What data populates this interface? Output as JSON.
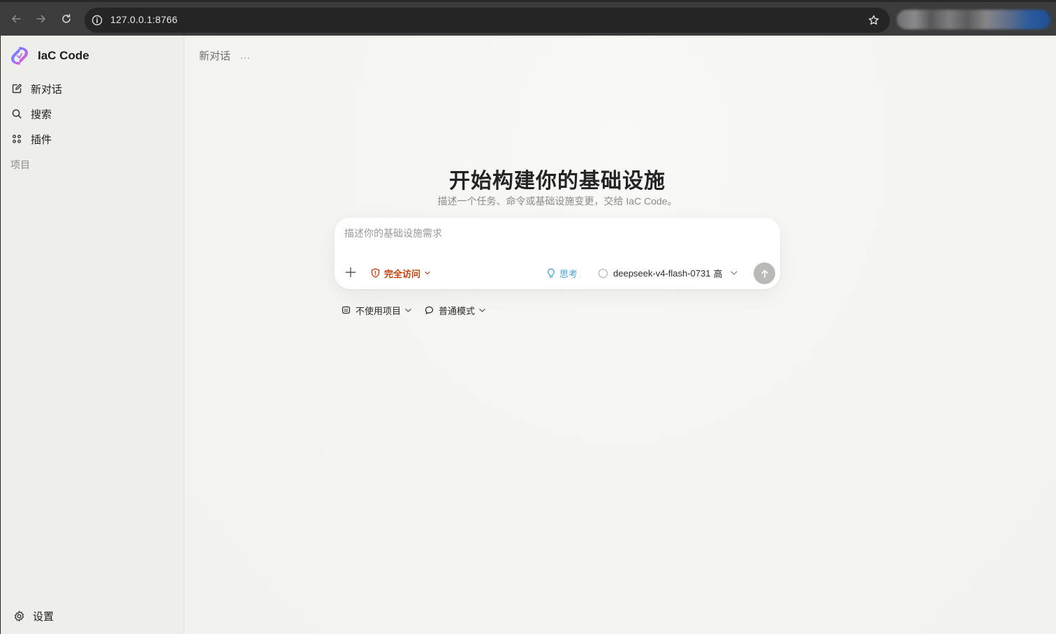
{
  "browser": {
    "url": "127.0.0.1:8766",
    "icons": [
      "back-icon",
      "forward-icon",
      "reload-icon",
      "info-icon",
      "star-icon"
    ]
  },
  "sidebar": {
    "brand": "IaC Code",
    "items": [
      {
        "label": "新对话",
        "icon": "new-chat-icon"
      },
      {
        "label": "搜索",
        "icon": "search-icon"
      },
      {
        "label": "插件",
        "icon": "plugins-icon"
      }
    ],
    "section_label": "项目",
    "settings_label": "设置"
  },
  "main": {
    "header_title": "新对话",
    "header_more": "...",
    "hero_title": "开始构建你的基础设施",
    "hero_subtitle": "描述一个任务、命令或基础设施变更，交给 IaC Code。",
    "composer": {
      "placeholder": "描述你的基础设施需求",
      "access_label": "完全访问",
      "think_label": "思考",
      "model_label": "deepseek-v4-flash-0731",
      "model_tier": "高"
    },
    "options": {
      "project_label": "不使用项目",
      "mode_label": "普通模式"
    }
  },
  "colors": {
    "access": "#c2410c",
    "think": "#4aa3d8",
    "send_disabled": "#b9b9b6",
    "sidebar_bg": "#eeeeeb",
    "main_bg": "#f4f4f1"
  }
}
